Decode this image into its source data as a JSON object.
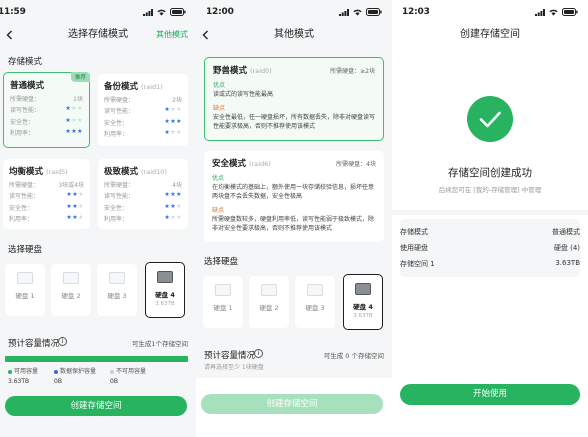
{
  "screen1": {
    "time": "11:59",
    "title": "选择存储模式",
    "nav_right": "其他模式",
    "section_mode": "存储模式",
    "modes": [
      {
        "name": "普通模式",
        "raid": "",
        "badge": "推荐",
        "rows": [
          {
            "label": "所需硬盘：",
            "value": "1块",
            "stars_on": 0,
            "stars_total": 0
          },
          {
            "label": "读写性能：",
            "value": "",
            "stars_on": 1,
            "stars_total": 3
          },
          {
            "label": "安全性：",
            "value": "",
            "stars_on": 1,
            "stars_total": 3
          },
          {
            "label": "利用率：",
            "value": "",
            "stars_on": 3,
            "stars_total": 3
          }
        ]
      },
      {
        "name": "备份模式",
        "raid": "(raid1)",
        "badge": "",
        "rows": [
          {
            "label": "所需硬盘：",
            "value": "2块",
            "stars_on": 0,
            "stars_total": 0
          },
          {
            "label": "读写性能：",
            "value": "",
            "stars_on": 1,
            "stars_total": 3
          },
          {
            "label": "安全性：",
            "value": "",
            "stars_on": 3,
            "stars_total": 3
          },
          {
            "label": "利用率：",
            "value": "",
            "stars_on": 1,
            "stars_total": 3
          }
        ]
      },
      {
        "name": "均衡模式",
        "raid": "(raid5)",
        "badge": "",
        "rows": [
          {
            "label": "所需硬盘：",
            "value": "3块或4块",
            "stars_on": 0,
            "stars_total": 0
          },
          {
            "label": "读写性能：",
            "value": "",
            "stars_on": 2,
            "stars_total": 3
          },
          {
            "label": "安全性：",
            "value": "",
            "stars_on": 2,
            "stars_total": 3
          },
          {
            "label": "利用率：",
            "value": "",
            "stars_on": 2,
            "stars_total": 3
          }
        ]
      },
      {
        "name": "极致模式",
        "raid": "(raid10)",
        "badge": "",
        "rows": [
          {
            "label": "所需硬盘：",
            "value": "4块",
            "stars_on": 0,
            "stars_total": 0
          },
          {
            "label": "读写性能：",
            "value": "",
            "stars_on": 3,
            "stars_total": 3
          },
          {
            "label": "安全性：",
            "value": "",
            "stars_on": 2,
            "stars_total": 3
          },
          {
            "label": "利用率：",
            "value": "",
            "stars_on": 1,
            "stars_total": 3
          }
        ]
      }
    ],
    "section_disk": "选择硬盘",
    "disks": [
      {
        "name": "硬盘 1",
        "cap": ""
      },
      {
        "name": "硬盘 2",
        "cap": ""
      },
      {
        "name": "硬盘 3",
        "cap": ""
      },
      {
        "name": "硬盘 4",
        "cap": "3.63TB"
      }
    ],
    "section_capacity": "预计容量情况",
    "capacity_right": "可生成1个存储空间",
    "capacity_fill": 1.0,
    "legend": [
      {
        "label": "可用容量",
        "value": "3.63TB",
        "color": "#27b35f"
      },
      {
        "label": "数据保护容量",
        "value": "0B",
        "color": "#2b6fe0"
      },
      {
        "label": "不可用容量",
        "value": "0B",
        "color": "#c8cdd3"
      }
    ],
    "button": "创建存储空间"
  },
  "screen2": {
    "time": "12:00",
    "title": "其他模式",
    "raids": [
      {
        "name": "野兽模式",
        "raid": "(raid0)",
        "disk": "所需硬盘：≥2块",
        "pros_label": "优点",
        "pros": "读或式的读写性能最高",
        "cons_label": "缺点",
        "cons": "安全性最低，任一硬盘损坏，所有数据丢失，除非对硬盘读写性能要求极高，否则不推荐使用该模式"
      },
      {
        "name": "安全模式",
        "raid": "(raid6)",
        "disk": "所需硬盘：4块",
        "pros_label": "优点",
        "pros": "在均衡模式的基础上，额外使用一块存储校验信息，损坏任意两块盘不会丢失数据，安全性极高",
        "cons_label": "缺点",
        "cons": "所需硬盘数较多，硬盘利用率低，读写性能弱于极致模式，除非对安全性要求极高，否则不推荐使用该模式"
      }
    ],
    "section_disk": "选择硬盘",
    "disks": [
      {
        "name": "硬盘 1",
        "cap": ""
      },
      {
        "name": "硬盘 2",
        "cap": ""
      },
      {
        "name": "硬盘 3",
        "cap": ""
      },
      {
        "name": "硬盘 4",
        "cap": "3.63TB"
      }
    ],
    "section_capacity": "预计容量情况",
    "capacity_right": "可生成 0 个存储空间",
    "capacity_hint": "请再选择至少 1块硬盘",
    "button": "创建存储空间"
  },
  "screen3": {
    "time": "12:03",
    "title": "创建存储空间",
    "success_title": "存储空间创建成功",
    "success_sub": "后续您可在 [我的-存储管理] 中管理",
    "summary": [
      {
        "label": "存储模式",
        "value": "普通模式"
      },
      {
        "label": "使用硬盘",
        "value": "硬盘 (4)"
      },
      {
        "label": "存储空间 1",
        "value": "3.63TB"
      }
    ],
    "button": "开始使用"
  },
  "colors": {
    "accent": "#27b35f",
    "star": "#2b6fe0",
    "warning": "#e07020"
  }
}
